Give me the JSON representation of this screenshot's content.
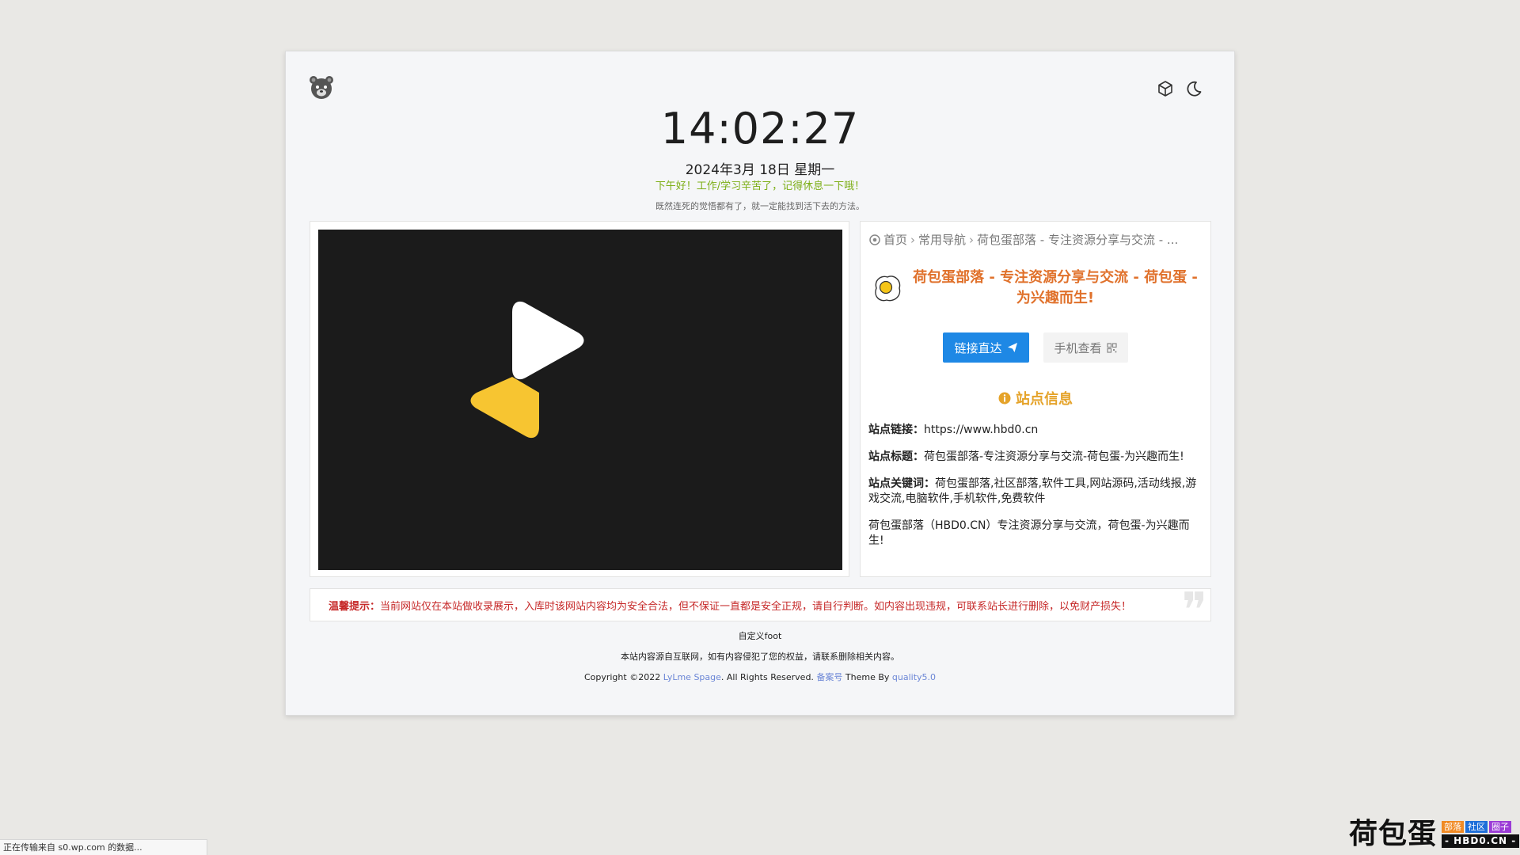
{
  "clock": {
    "time": "14:02:27"
  },
  "date": {
    "text": "2024年3月 18日 星期一"
  },
  "greeting": "下午好！工作/学习辛苦了，记得休息一下哦！",
  "motto": "既然连死的觉悟都有了，就一定能找到活下去的方法。",
  "top_icons": [
    "cube-icon",
    "moon-icon"
  ],
  "breadcrumb": {
    "items": [
      "首页",
      "常用导航",
      "荷包蛋部落 - 专注资源分享与交流 - ..."
    ],
    "separator": "›"
  },
  "site": {
    "title": "荷包蛋部落 - 专注资源分享与交流 - 荷包蛋 - 为兴趣而生!",
    "visit_button": "链接直达",
    "mobile_button": "手机查看",
    "info_title": "站点信息",
    "link_label": "站点链接：",
    "link_value": "https://www.hbd0.cn",
    "title_label": "站点标题：",
    "title_value": "荷包蛋部落-专注资源分享与交流-荷包蛋-为兴趣而生!",
    "keywords_label": "站点关键词：",
    "keywords_value": "荷包蛋部落,社区部落,软件工具,网站源码,活动线报,游戏交流,电脑软件,手机软件,免费软件",
    "description": "荷包蛋部落（HBD0.CN）专注资源分享与交流，荷包蛋-为兴趣而生!"
  },
  "notice": {
    "label": "温馨提示：",
    "text": "当前网站仅在本站做收录展示，入库时该网站内容均为安全合法，但不保证一直都是安全正规，请自行判断。如内容出现违规，可联系站长进行删除，以免财产损失！"
  },
  "footer": {
    "custom": "自定义foot",
    "disclaimer": "本站内容源自互联网，如有内容侵犯了您的权益，请联系删除相关内容。",
    "copyright_prefix": "Copyright ©2022 ",
    "brand_link": "LyLme Spage",
    "rights": ". All Rights Reserved. ",
    "icp_link": "备案号",
    "theme_by": " Theme By ",
    "theme_link": "quality5.0"
  },
  "statusbar": "正在传输来自 s0.wp.com 的数据...",
  "watermark": {
    "cn": "荷包蛋",
    "tags": [
      "部落",
      "社区",
      "圈子"
    ],
    "tag_colors": [
      "#f08a24",
      "#1e6fd9",
      "#9b3cd6"
    ],
    "domain": "- HBD0.CN -"
  },
  "colors": {
    "accent_blue": "#1e88e5",
    "title_orange": "#e0712b",
    "greeting_green": "#7cae15",
    "notice_red": "#c62828",
    "info_gold": "#e5a32a"
  }
}
